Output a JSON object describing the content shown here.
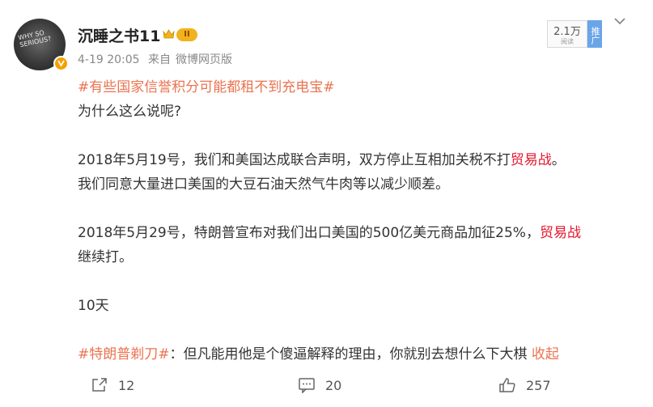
{
  "header": {
    "username": "沉睡之书11",
    "level_badge": "II",
    "avatar_text": "WHY SO SERIOUS?",
    "date": "4-19 20:05",
    "source_prefix": "来自",
    "source": "微博网页版",
    "read_count": "2.1万",
    "read_label": "阅读",
    "promote_label": "推广"
  },
  "post": {
    "topic1": "#有些国家信誉积分可能都租不到充电宝#",
    "line_q": "为什么这么说呢?",
    "p1_a": "2018年5月19号，我们和美国达成联合声明，双方停止互相加关税不打",
    "p1_hl": "贸易战",
    "p1_end": "。",
    "p1_b": "我们同意大量进口美国的大豆石油天然气牛肉等以减少顺差。",
    "p2_a": "2018年5月29号，特朗普宣布对我们出口美国的500亿美元商品加征25%，",
    "p2_hl": "贸易战",
    "p2_b": "继续打。",
    "p3": "10天",
    "topic2": "#特朗普剃刀#",
    "p4_text": "：但凡能用他是个傻逼解释的理由，你就别去想什么下大棋",
    "collapse": "收起"
  },
  "actions": {
    "share_count": "12",
    "comment_count": "20",
    "like_count": "257"
  },
  "colors": {
    "topic": "#eb7350",
    "highlight": "#e6162d",
    "badge": "#f2b21b",
    "promote": "#6aa5e8"
  }
}
